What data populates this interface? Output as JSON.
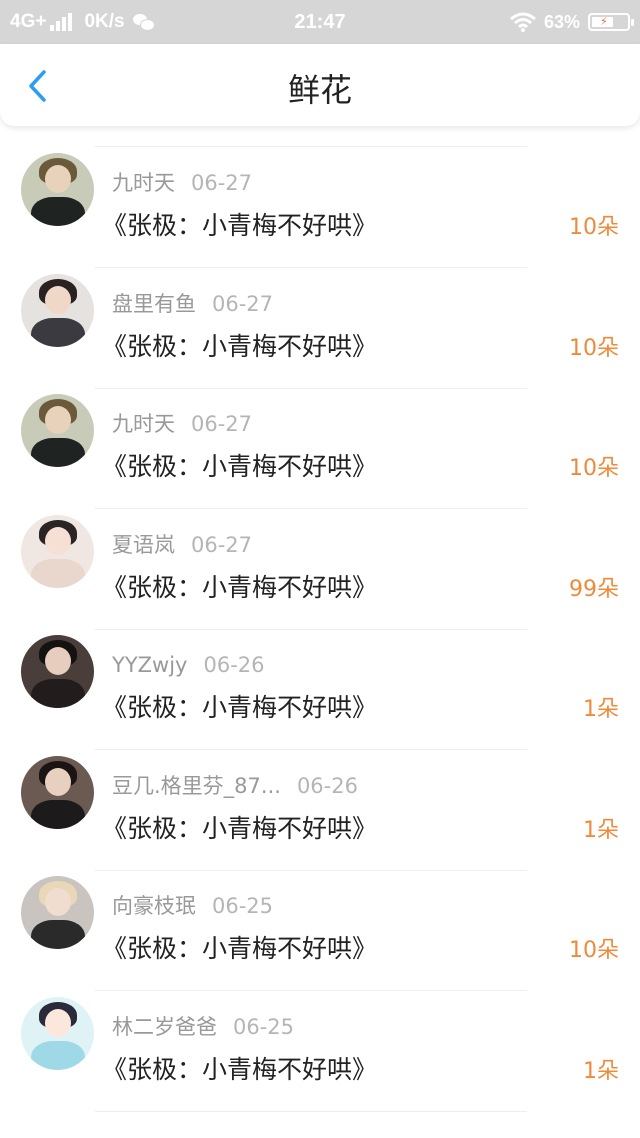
{
  "status_bar": {
    "network": "4G+",
    "speed": "0K/s",
    "time": "21:47",
    "battery": "63%",
    "battery_level": 0.63,
    "icons": [
      "signal-icon",
      "wechat-icon",
      "wifi-icon",
      "battery-icon"
    ]
  },
  "nav": {
    "title": "鲜花",
    "back_icon": "chevron-left-icon",
    "accent_color": "#2a9df4"
  },
  "colors": {
    "count": "#f08a3a",
    "name": "#999999",
    "date": "#b5b5b5",
    "title": "#222222"
  },
  "items": [
    {
      "user": "九时天",
      "date": "06-27",
      "book": "《张极：小青梅不好哄》",
      "count": "10朵",
      "avatar": "group-photo-avatar"
    },
    {
      "user": "盘里有鱼",
      "date": "06-27",
      "book": "《张极：小青梅不好哄》",
      "count": "10朵",
      "avatar": "boy-portrait-avatar"
    },
    {
      "user": "九时天",
      "date": "06-27",
      "book": "《张极：小青梅不好哄》",
      "count": "10朵",
      "avatar": "group-photo-avatar"
    },
    {
      "user": "夏语岚",
      "date": "06-27",
      "book": "《张极：小青梅不好哄》",
      "count": "99朵",
      "avatar": "girl-portrait-avatar"
    },
    {
      "user": "YYZwjy",
      "date": "06-26",
      "book": "《张极：小青梅不好哄》",
      "count": "1朵",
      "avatar": "boy-dark-avatar"
    },
    {
      "user": "豆几.格里芬_87...",
      "date": "06-26",
      "book": "《张极：小青梅不好哄》",
      "count": "1朵",
      "avatar": "boy-suit-avatar"
    },
    {
      "user": "向豪枝珉",
      "date": "06-25",
      "book": "《张极：小青梅不好哄》",
      "count": "10朵",
      "avatar": "blonde-avatar"
    },
    {
      "user": "林二岁爸爸",
      "date": "06-25",
      "book": "《张极：小青梅不好哄》",
      "count": "1朵",
      "avatar": "cartoon-avatar"
    }
  ]
}
